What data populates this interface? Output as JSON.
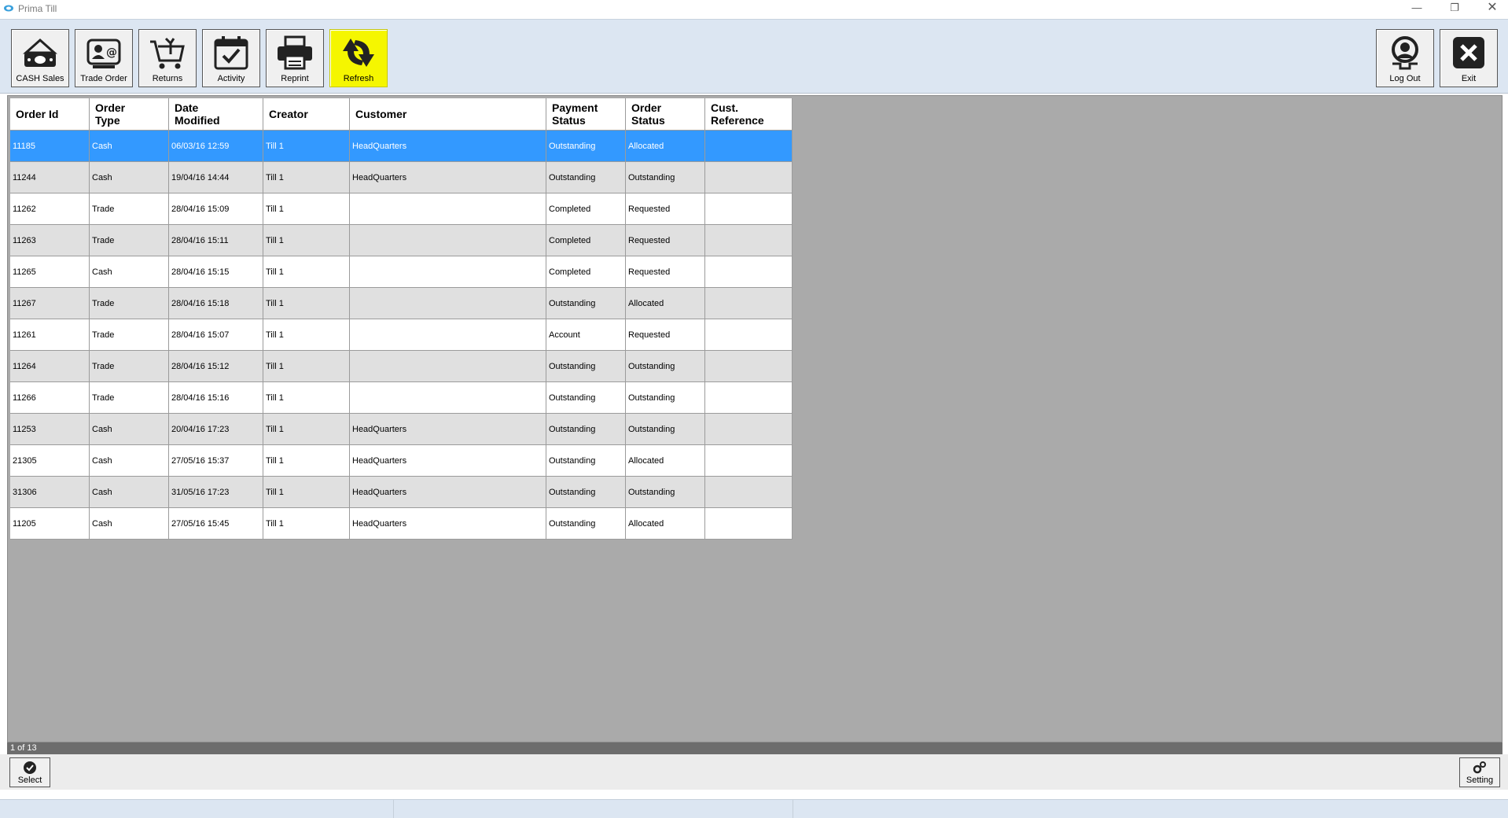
{
  "window": {
    "title": "Prima Till",
    "min_icon": "minimize-icon",
    "restore_icon": "restore-icon",
    "close_icon": "close-icon"
  },
  "toolbar": {
    "buttons": [
      {
        "label": "CASH Sales",
        "icon": "cash-register-icon"
      },
      {
        "label": "Trade Order",
        "icon": "contact-card-icon"
      },
      {
        "label": "Returns",
        "icon": "cart-return-icon"
      },
      {
        "label": "Activity",
        "icon": "calendar-check-icon"
      },
      {
        "label": "Reprint",
        "icon": "printer-icon"
      },
      {
        "label": "Refresh",
        "icon": "refresh-arrows-icon"
      }
    ],
    "right_buttons": [
      {
        "label": "Log Out",
        "icon": "user-logout-icon"
      },
      {
        "label": "Exit",
        "icon": "exit-x-icon"
      }
    ],
    "highlight_color": "#f5f600"
  },
  "grid": {
    "columns": [
      {
        "line1": "Order Id",
        "line2": ""
      },
      {
        "line1": "Order",
        "line2": "Type"
      },
      {
        "line1": "Date",
        "line2": "Modified"
      },
      {
        "line1": "Creator",
        "line2": ""
      },
      {
        "line1": "Customer",
        "line2": ""
      },
      {
        "line1": "Payment",
        "line2": "Status"
      },
      {
        "line1": "Order",
        "line2": "Status"
      },
      {
        "line1": "Cust.",
        "line2": "Reference"
      }
    ],
    "rows": [
      [
        "11185",
        "Cash",
        "06/03/16 12:59",
        "Till 1",
        "HeadQuarters",
        "Outstanding",
        "Allocated",
        ""
      ],
      [
        "11244",
        "Cash",
        "19/04/16 14:44",
        "Till 1",
        "HeadQuarters",
        "Outstanding",
        "Outstanding",
        ""
      ],
      [
        "11262",
        "Trade",
        "28/04/16 15:09",
        "Till 1",
        "",
        "Completed",
        "Requested",
        ""
      ],
      [
        "11263",
        "Trade",
        "28/04/16 15:11",
        "Till 1",
        "",
        "Completed",
        "Requested",
        ""
      ],
      [
        "11265",
        "Cash",
        "28/04/16 15:15",
        "Till 1",
        "",
        "Completed",
        "Requested",
        ""
      ],
      [
        "11267",
        "Trade",
        "28/04/16 15:18",
        "Till 1",
        "",
        "Outstanding",
        "Allocated",
        ""
      ],
      [
        "11261",
        "Trade",
        "28/04/16 15:07",
        "Till 1",
        "",
        "Account",
        "Requested",
        ""
      ],
      [
        "11264",
        "Trade",
        "28/04/16 15:12",
        "Till 1",
        "",
        "Outstanding",
        "Outstanding",
        ""
      ],
      [
        "11266",
        "Trade",
        "28/04/16 15:16",
        "Till 1",
        "",
        "Outstanding",
        "Outstanding",
        ""
      ],
      [
        "11253",
        "Cash",
        "20/04/16 17:23",
        "Till 1",
        "HeadQuarters",
        "Outstanding",
        "Outstanding",
        ""
      ],
      [
        "21305",
        "Cash",
        "27/05/16 15:37",
        "Till 1",
        "HeadQuarters",
        "Outstanding",
        "Allocated",
        ""
      ],
      [
        "31306",
        "Cash",
        "31/05/16 17:23",
        "Till 1",
        "HeadQuarters",
        "Outstanding",
        "Outstanding",
        ""
      ],
      [
        "11205",
        "Cash",
        "27/05/16 15:45",
        "Till 1",
        "HeadQuarters",
        "Outstanding",
        "Allocated",
        ""
      ]
    ],
    "selected_row": 0,
    "selected_color": "#3399ff"
  },
  "pager": {
    "text": "1 of 13"
  },
  "bottom": {
    "select_label": "Select",
    "setting_label": "Setting",
    "select_icon": "check-circle-icon",
    "setting_icon": "gears-icon"
  }
}
